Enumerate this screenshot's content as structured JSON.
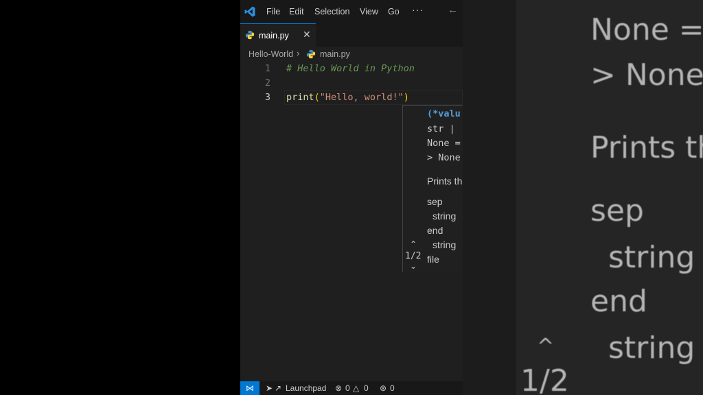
{
  "menu": {
    "file": "File",
    "edit": "Edit",
    "selection": "Selection",
    "view": "View",
    "go": "Go",
    "more": "···"
  },
  "tab": {
    "label": "main.py"
  },
  "breadcrumb": {
    "folder": "Hello-World",
    "file": "main.py"
  },
  "editor": {
    "lines": [
      {
        "number": "1",
        "comment": "# Hello World in Python"
      },
      {
        "number": "2"
      },
      {
        "number": "3",
        "fn": "print",
        "open": "(",
        "string": "\"Hello, world!\"",
        "close": ")"
      }
    ]
  },
  "hover": {
    "count": "1/2",
    "sig1": "(*valu",
    "sig2": "str | ",
    "sig3": "None =",
    "sig4": "> None",
    "desc": "Prints th",
    "p1": "sep",
    "p1d": "string",
    "p2": "end",
    "p2d": "string",
    "p3": "file"
  },
  "status": {
    "launchpad": "Launchpad",
    "errors": "0",
    "warnings": "0",
    "ports": "0"
  },
  "background_zoom": {
    "l1": "None  =",
    "l2": ">  None",
    "l3": "Prints th",
    "l4": "sep",
    "l5": "string",
    "l6": "end",
    "l7": "string",
    "count": "1/2"
  },
  "colors": {
    "accent": "#0078d4",
    "editor_bg": "#1f1f1f",
    "keyword": "#569cd6",
    "string": "#ce9178",
    "comment": "#6a9955"
  }
}
